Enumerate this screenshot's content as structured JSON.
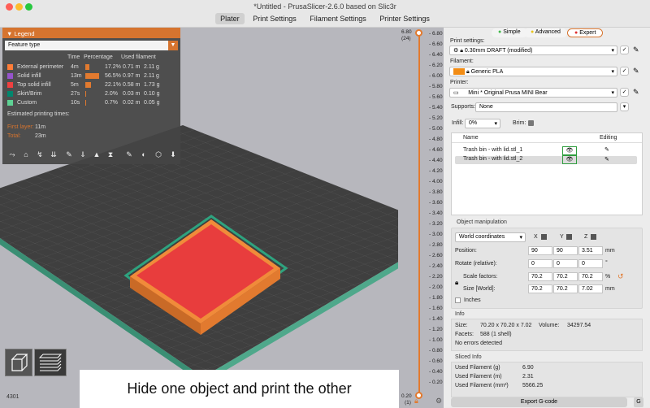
{
  "window": {
    "title": "*Untitled - PrusaSlicer-2.6.0 based on Slic3r",
    "tabs": [
      "Plater",
      "Print Settings",
      "Filament Settings",
      "Printer Settings"
    ]
  },
  "legend": {
    "title": "Legend",
    "view_type": "Feature type",
    "headers": {
      "time": "Time",
      "percentage": "Percentage",
      "used_filament": "Used filament"
    },
    "rows": [
      {
        "name": "External perimeter",
        "time": "4m",
        "pct": "17.2%",
        "pct_value": 17.2,
        "len": "0.71 m",
        "weight": "2.11 g",
        "color": "#ff7d38"
      },
      {
        "name": "Solid infill",
        "time": "13m",
        "pct": "56.5%",
        "pct_value": 56.5,
        "len": "0.97 m",
        "weight": "2.11 g",
        "color": "#9654cc"
      },
      {
        "name": "Top solid infill",
        "time": "5m",
        "pct": "22.1%",
        "pct_value": 22.1,
        "len": "0.58 m",
        "weight": "1.73 g",
        "color": "#f04040"
      },
      {
        "name": "Skirt/Brim",
        "time": "27s",
        "pct": "2.0%",
        "pct_value": 2.0,
        "len": "0.03 m",
        "weight": "0.10 g",
        "color": "#00876e"
      },
      {
        "name": "Custom",
        "time": "10s",
        "pct": "0.7%",
        "pct_value": 0.7,
        "len": "0.02 m",
        "weight": "0.05 g",
        "color": "#5ed194"
      }
    ],
    "estimated_label": "Estimated printing times:",
    "first_layer_label": "First layer:",
    "first_layer_value": "11m",
    "total_label": "Total:",
    "total_value": "23m"
  },
  "slider": {
    "top_value": "6.80",
    "top_layer": "(24)",
    "ticks": [
      "6.80",
      "6.60",
      "6.40",
      "6.20",
      "6.00",
      "5.80",
      "5.60",
      "5.40",
      "5.20",
      "5.00",
      "4.80",
      "4.60",
      "4.40",
      "4.20",
      "4.00",
      "3.80",
      "3.60",
      "3.40",
      "3.20",
      "3.00",
      "2.80",
      "2.60",
      "2.40",
      "2.20",
      "2.00",
      "1.80",
      "1.60",
      "1.40",
      "1.20",
      "1.00",
      "0.80",
      "0.60",
      "0.40",
      "0.20"
    ],
    "bottom_value": "0.20",
    "bottom_layer": "(1)",
    "h_value": "4301"
  },
  "modes": {
    "simple": "Simple",
    "advanced": "Advanced",
    "expert": "Expert"
  },
  "settings": {
    "print_label": "Print settings:",
    "print_value": "0.30mm DRAFT (modified)",
    "filament_label": "Filament:",
    "filament_value": "Generic PLA",
    "filament_color": "#f28c14",
    "printer_label": "Printer:",
    "printer_value": "Mini * Original Prusa MINI Bear",
    "supports_label": "Supports:",
    "supports_value": "None",
    "infill_label": "Infill:",
    "infill_value": "0%",
    "brim_label": "Brim:"
  },
  "objects": {
    "col_name": "Name",
    "col_editing": "Editing",
    "items": [
      "Trash bin - with lid.stl_1",
      "Trash bin - with lid.stl_2"
    ]
  },
  "manipulation": {
    "title": "Object manipulation",
    "coord_value": "World coordinates",
    "axes": [
      "X",
      "Y",
      "Z"
    ],
    "position_label": "Position:",
    "position": [
      "90",
      "90",
      "3.51"
    ],
    "position_unit": "mm",
    "rotate_label": "Rotate (relative):",
    "rotate": [
      "0",
      "0",
      "0"
    ],
    "rotate_unit": "°",
    "scale_label": "Scale factors:",
    "scale": [
      "70.2",
      "70.2",
      "70.2"
    ],
    "scale_unit": "%",
    "size_label": "Size [World]:",
    "size": [
      "70.2",
      "70.2",
      "7.02"
    ],
    "size_unit": "mm",
    "inches_label": "Inches"
  },
  "info": {
    "title": "Info",
    "size_label": "Size:",
    "size_value": "70.20 x 70.20 x 7.02",
    "volume_label": "Volume:",
    "volume_value": "34297.54",
    "facets_label": "Facets:",
    "facets_value": "588 (1 shell)",
    "errors_value": "No errors detected"
  },
  "sliced": {
    "title": "Sliced Info",
    "rows": [
      {
        "label": "Used Filament (g)",
        "value": "6.90"
      },
      {
        "label": "Used Filament (m)",
        "value": "2.31"
      },
      {
        "label": "Used Filament (mm³)",
        "value": "5566.25"
      }
    ]
  },
  "export_label": "Export G-code",
  "caption": "Hide one object and print the other"
}
